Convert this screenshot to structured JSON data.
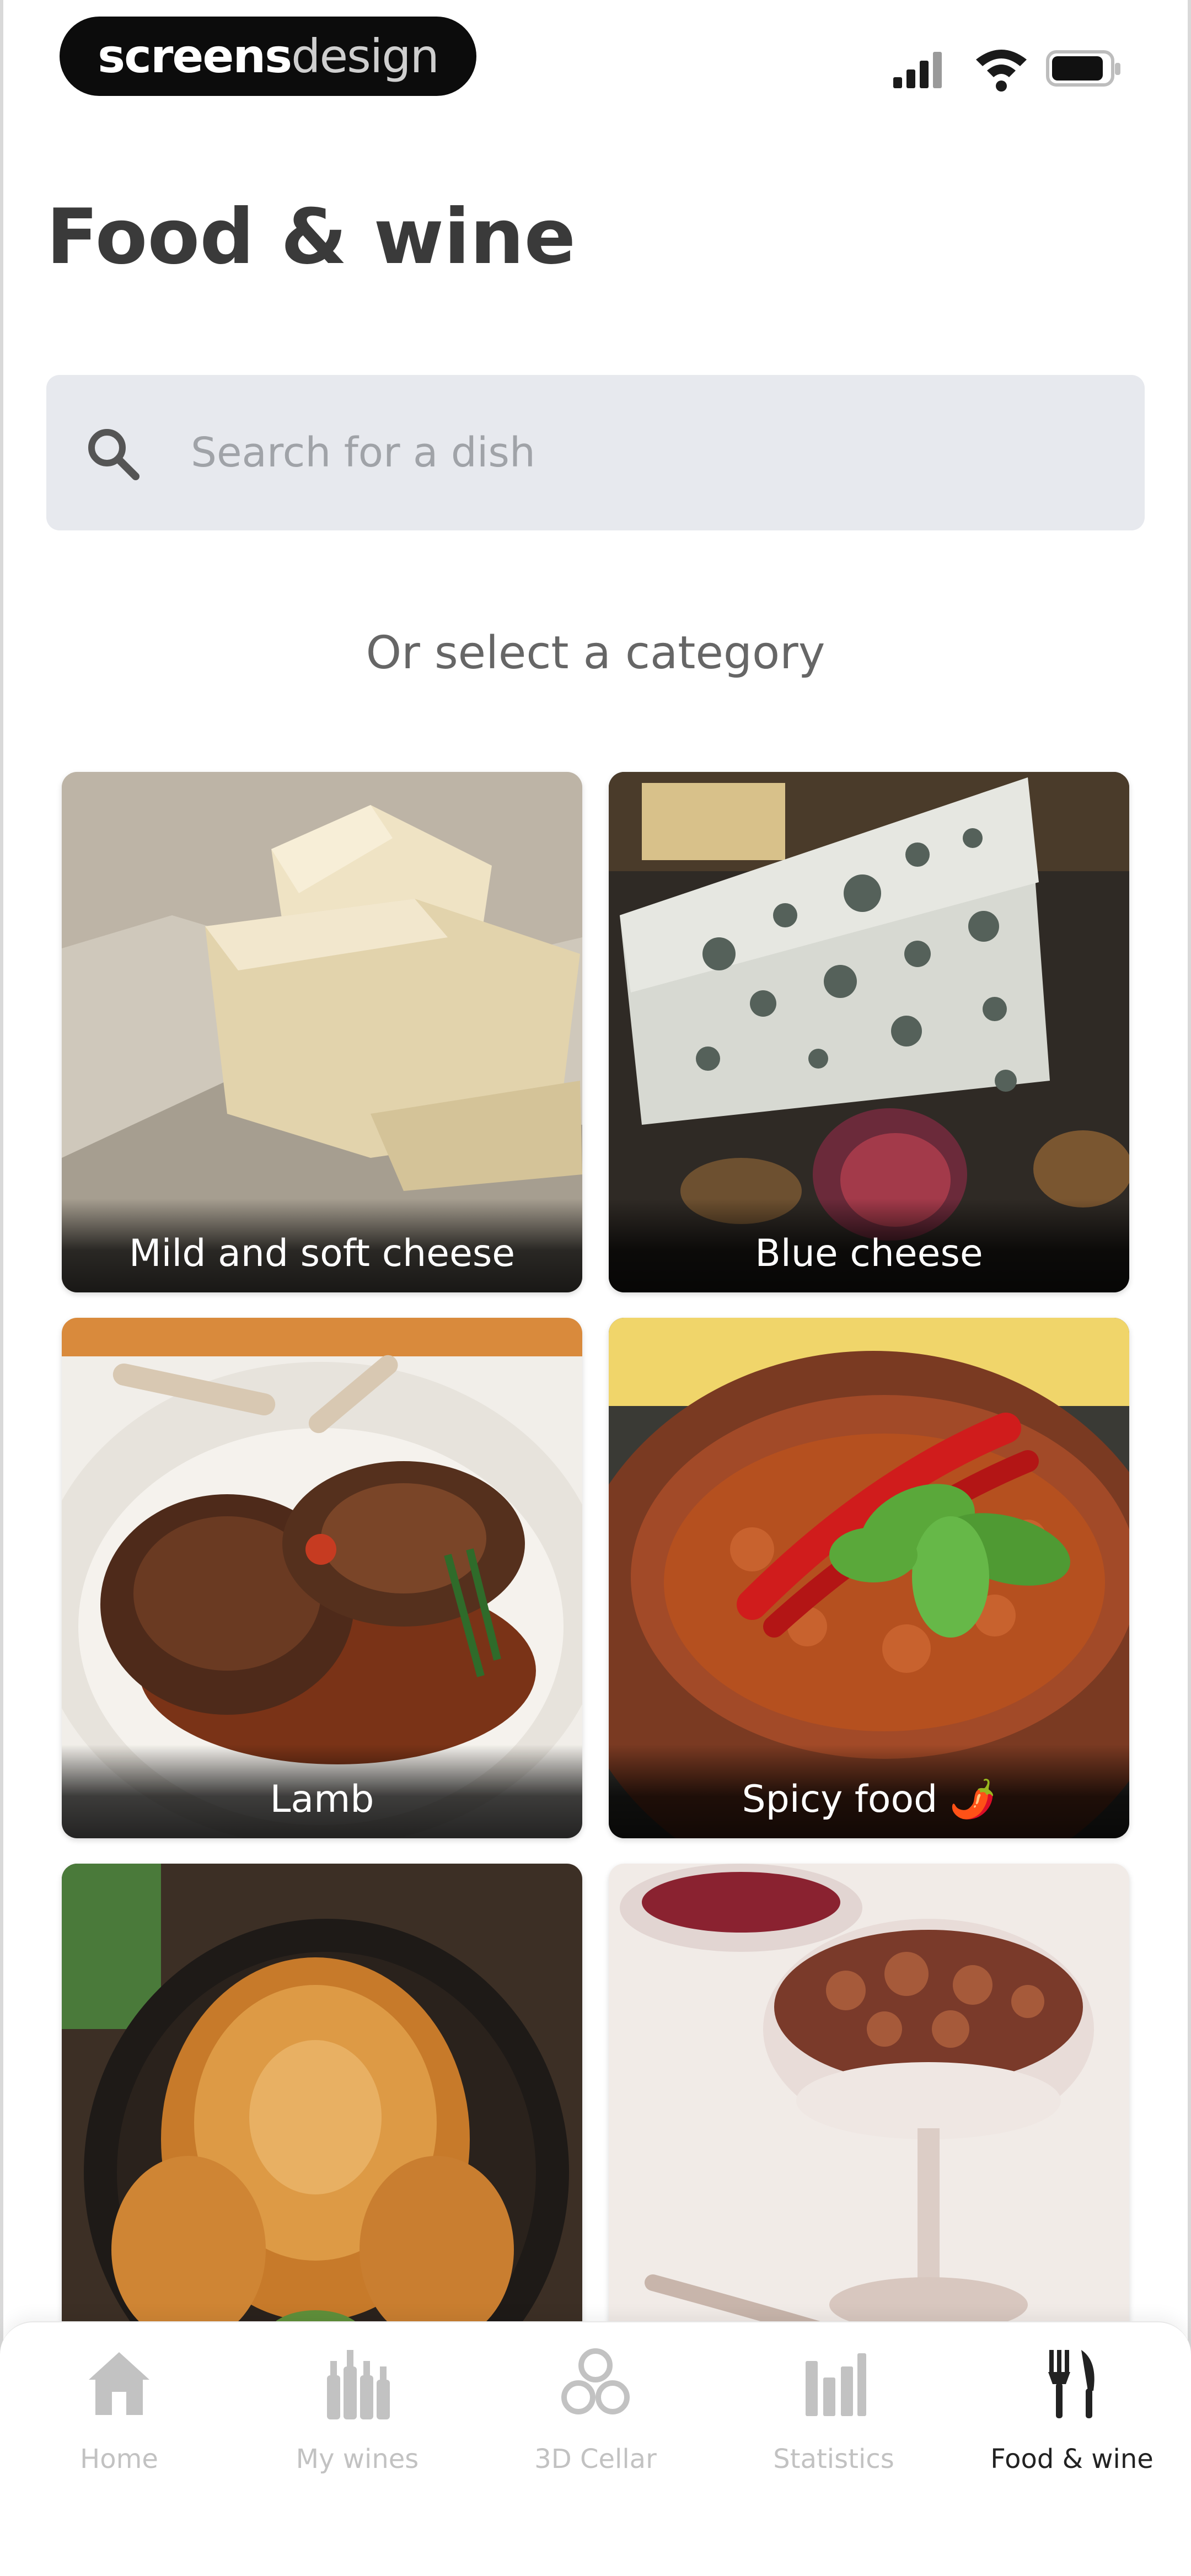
{
  "status_bar": {
    "brand": {
      "bold": "screens",
      "thin": "design"
    }
  },
  "page_title": "Food & wine",
  "search": {
    "placeholder": "Search for a dish"
  },
  "category_hint": "Or select a category",
  "categories": [
    {
      "label": "Mild and soft cheese"
    },
    {
      "label": "Blue cheese"
    },
    {
      "label": "Lamb"
    },
    {
      "label": "Spicy food 🌶️"
    },
    {
      "label": ""
    },
    {
      "label": ""
    }
  ],
  "tab_bar": {
    "items": [
      {
        "label": "Home",
        "icon": "home-icon"
      },
      {
        "label": "My wines",
        "icon": "bottles-icon"
      },
      {
        "label": "3D Cellar",
        "icon": "cellar-icon"
      },
      {
        "label": "Statistics",
        "icon": "bar-chart-icon"
      },
      {
        "label": "Food & wine",
        "icon": "fork-knife-icon",
        "active": true
      }
    ]
  },
  "colors": {
    "accent": "#222222",
    "inactive": "#c2c2c2",
    "search_bg": "#e7e9ee"
  }
}
